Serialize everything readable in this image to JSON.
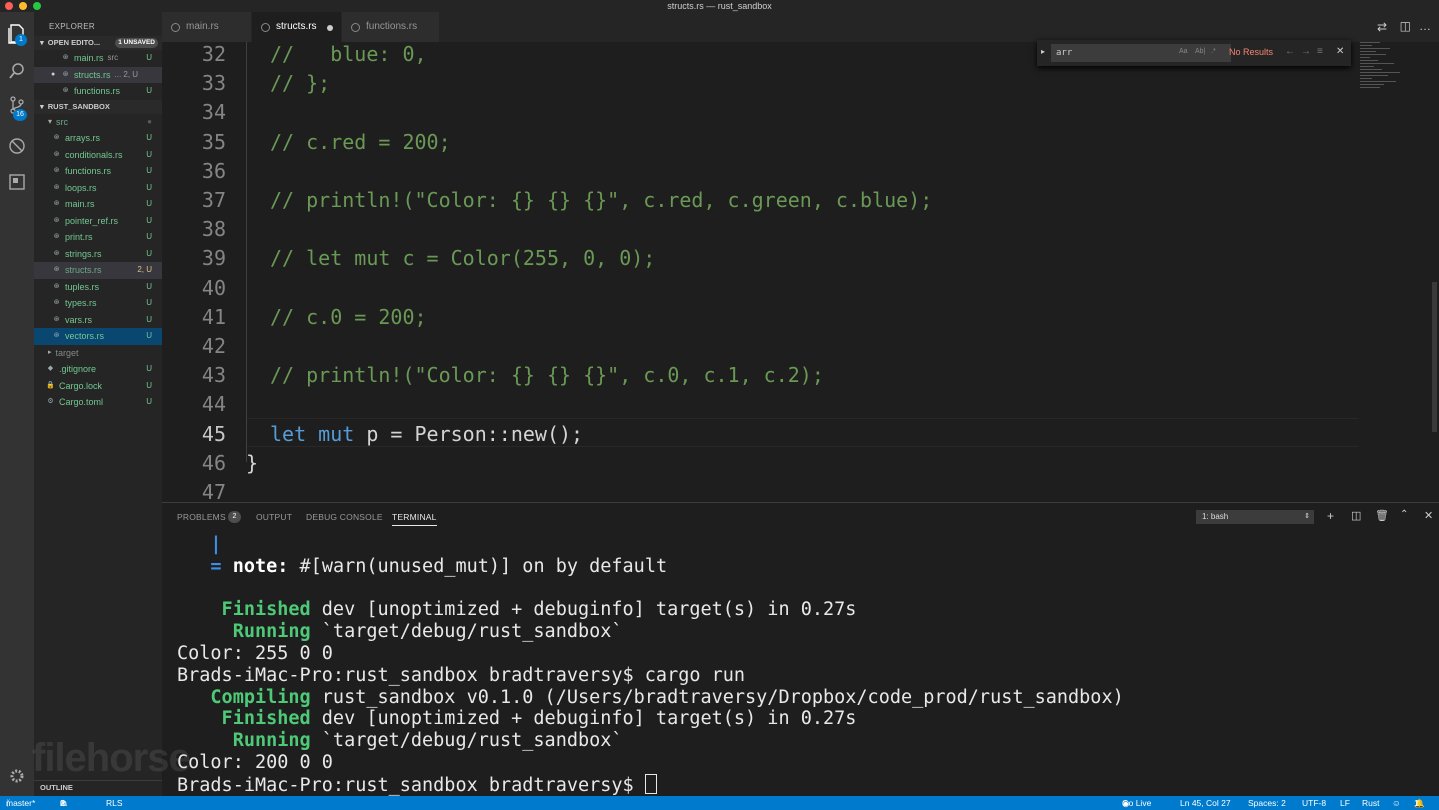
{
  "window": {
    "title": "structs.rs — rust_sandbox"
  },
  "activity": {
    "scm_badge": "16",
    "explorer_badge": "1"
  },
  "explorer": {
    "header": "EXPLORER",
    "open_editors": {
      "label": "OPEN EDITO...",
      "badge": "1 UNSAVED",
      "items": [
        {
          "name": "main.rs",
          "sub": "src",
          "status": "U"
        },
        {
          "name": "structs.rs",
          "sub": "... 2, U",
          "status": ""
        },
        {
          "name": "functions.rs",
          "sub": "",
          "status": "U"
        }
      ]
    },
    "project": {
      "label": "RUST_SANDBOX",
      "src_label": "src",
      "files": [
        {
          "name": "arrays.rs",
          "status": "U"
        },
        {
          "name": "conditionals.rs",
          "status": "U"
        },
        {
          "name": "functions.rs",
          "status": "U"
        },
        {
          "name": "loops.rs",
          "status": "U"
        },
        {
          "name": "main.rs",
          "status": "U"
        },
        {
          "name": "pointer_ref.rs",
          "status": "U"
        },
        {
          "name": "print.rs",
          "status": "U"
        },
        {
          "name": "strings.rs",
          "status": "U"
        },
        {
          "name": "structs.rs",
          "status": "2, U"
        },
        {
          "name": "tuples.rs",
          "status": "U"
        },
        {
          "name": "types.rs",
          "status": "U"
        },
        {
          "name": "vars.rs",
          "status": "U"
        },
        {
          "name": "vectors.rs",
          "status": "U"
        }
      ],
      "target_label": "target",
      "root_files": [
        {
          "name": ".gitignore",
          "status": "U"
        },
        {
          "name": "Cargo.lock",
          "status": "U"
        },
        {
          "name": "Cargo.toml",
          "status": "U"
        }
      ]
    },
    "outline_label": "OUTLINE"
  },
  "tabs": [
    {
      "label": "main.rs"
    },
    {
      "label": "structs.rs"
    },
    {
      "label": "functions.rs"
    }
  ],
  "find": {
    "query": "arr",
    "case": "Aa",
    "word": "Ab|",
    "regex": ".*",
    "result": "No Results"
  },
  "editor": {
    "lines": [
      {
        "n": "32",
        "parts": [
          {
            "c": "cm",
            "t": "//   blue: 0,"
          }
        ]
      },
      {
        "n": "33",
        "parts": [
          {
            "c": "cm",
            "t": "// };"
          }
        ]
      },
      {
        "n": "34",
        "parts": []
      },
      {
        "n": "35",
        "parts": [
          {
            "c": "cm",
            "t": "// c.red = 200;"
          }
        ]
      },
      {
        "n": "36",
        "parts": []
      },
      {
        "n": "37",
        "parts": [
          {
            "c": "cm",
            "t": "// println!(\"Color: {} {} {}\", c.red, c.green, c.blue);"
          }
        ]
      },
      {
        "n": "38",
        "parts": []
      },
      {
        "n": "39",
        "parts": [
          {
            "c": "cm",
            "t": "// let mut c = Color(255, 0, 0);"
          }
        ]
      },
      {
        "n": "40",
        "parts": []
      },
      {
        "n": "41",
        "parts": [
          {
            "c": "cm",
            "t": "// c.0 = 200;"
          }
        ]
      },
      {
        "n": "42",
        "parts": []
      },
      {
        "n": "43",
        "parts": [
          {
            "c": "cm",
            "t": "// println!(\"Color: {} {} {}\", c.0, c.1, c.2);"
          }
        ]
      },
      {
        "n": "44",
        "parts": []
      },
      {
        "n": "45",
        "parts": [
          {
            "c": "kw",
            "t": "let"
          },
          {
            "c": "tx",
            "t": " "
          },
          {
            "c": "kw",
            "t": "mut"
          },
          {
            "c": "tx",
            "t": " p = Person::new();"
          }
        ]
      },
      {
        "n": "46",
        "parts": [
          {
            "c": "tx",
            "t": "}"
          }
        ],
        "indent": "0"
      },
      {
        "n": "47",
        "parts": []
      }
    ]
  },
  "panel": {
    "tabs": {
      "problems": "PROBLEMS",
      "problems_count": "2",
      "output": "OUTPUT",
      "debug": "DEBUG CONSOLE",
      "terminal": "TERMINAL"
    },
    "shell_select": "1: bash",
    "terminal": [
      [
        {
          "c": "tb",
          "t": "   |"
        }
      ],
      [
        {
          "c": "tb",
          "t": "   = "
        },
        {
          "c": "tw",
          "t": "note:"
        },
        {
          "c": "",
          "t": " #[warn(unused_mut)] on by default"
        }
      ],
      [
        {
          "c": "",
          "t": ""
        }
      ],
      [
        {
          "c": "tg",
          "t": "    Finished"
        },
        {
          "c": "",
          "t": " dev [unoptimized + debuginfo] target(s) in 0.27s"
        }
      ],
      [
        {
          "c": "tg",
          "t": "     Running"
        },
        {
          "c": "",
          "t": " `target/debug/rust_sandbox`"
        }
      ],
      [
        {
          "c": "",
          "t": "Color: 255 0 0"
        }
      ],
      [
        {
          "c": "",
          "t": "Brads-iMac-Pro:rust_sandbox bradtraversy$ cargo run"
        }
      ],
      [
        {
          "c": "tg",
          "t": "   Compiling"
        },
        {
          "c": "",
          "t": " rust_sandbox v0.1.0 (/Users/bradtraversy/Dropbox/code_prod/rust_sandbox)"
        }
      ],
      [
        {
          "c": "tg",
          "t": "    Finished"
        },
        {
          "c": "",
          "t": " dev [unoptimized + debuginfo] target(s) in 0.27s"
        }
      ],
      [
        {
          "c": "tg",
          "t": "     Running"
        },
        {
          "c": "",
          "t": " `target/debug/rust_sandbox`"
        }
      ],
      [
        {
          "c": "",
          "t": "Color: 200 0 0"
        }
      ],
      [
        {
          "c": "",
          "t": "Brads-iMac-Pro:rust_sandbox bradtraversy$ "
        }
      ]
    ]
  },
  "status": {
    "branch": "master*",
    "errors": "0",
    "warnings": "2",
    "rls": "RLS",
    "golive": "Go Live",
    "position": "Ln 45, Col 27",
    "spaces": "Spaces: 2",
    "encoding": "UTF-8",
    "eol": "LF",
    "language": "Rust",
    "notifications": "1"
  },
  "watermark": "filehorse"
}
